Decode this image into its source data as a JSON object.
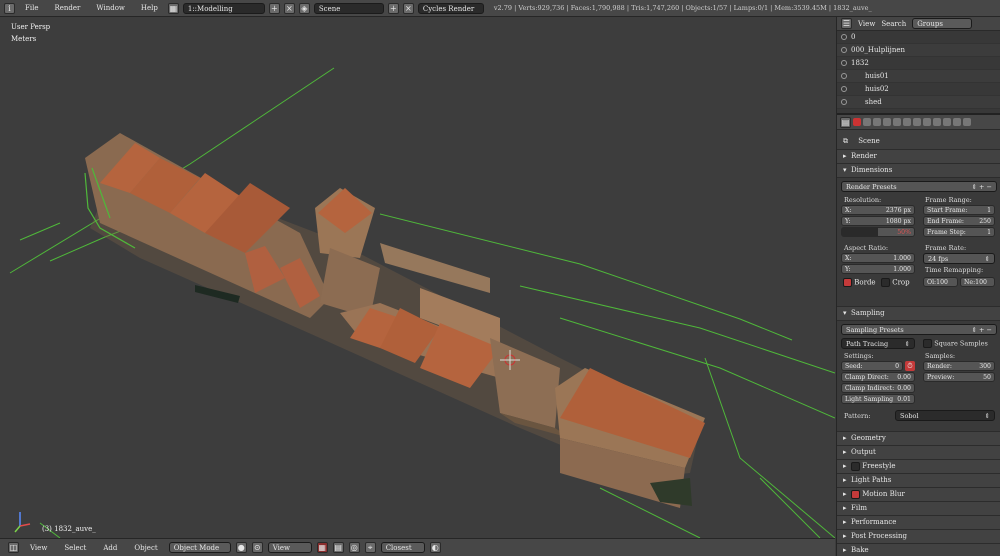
{
  "topbar": {
    "menus": [
      "File",
      "Render",
      "Window",
      "Help"
    ],
    "screen_layout": "1::Modelling",
    "scene": "Scene",
    "render_engine": "Cycles Render",
    "stats": "v2.79 | Verts:929,736 | Faces:1,790,988 | Tris:1,747,260 | Objects:1/57 | Lamps:0/1 | Mem:3539.45M | 1832_auve_"
  },
  "viewport": {
    "view_name": "User Persp",
    "units": "Meters",
    "object_label": "(3) 1832_auve_"
  },
  "bottombar": {
    "menus": [
      "View",
      "Select",
      "Add",
      "Object"
    ],
    "mode": "Object Mode",
    "pivot": "View",
    "snap": "Closest"
  },
  "outliner": {
    "header": {
      "view": "View",
      "search": "Search",
      "display": "Groups"
    },
    "rows": [
      {
        "name": "0"
      },
      {
        "name": "000_Hulplijnen"
      },
      {
        "name": "1832"
      },
      {
        "name": "huis01"
      },
      {
        "name": "huis02"
      },
      {
        "name": "shed"
      }
    ]
  },
  "properties": {
    "context": "Scene",
    "sections": {
      "render": "Render",
      "dimensions": "Dimensions",
      "sampling": "Sampling",
      "geometry": "Geometry",
      "output": "Output",
      "freestyle": "Freestyle",
      "light_paths": "Light Paths",
      "motion_blur": "Motion Blur",
      "film": "Film",
      "performance": "Performance",
      "post_processing": "Post Processing",
      "bake": "Bake"
    },
    "dimensions": {
      "presets": "Render Presets",
      "resolution_label": "Resolution:",
      "res_x_label": "X:",
      "res_x": "2376 px",
      "res_y_label": "Y:",
      "res_y": "1080 px",
      "res_pct": "50%",
      "frame_range_label": "Frame Range:",
      "start_label": "Start Frame:",
      "start": "1",
      "end_label": "End Frame:",
      "end": "250",
      "step_label": "Frame Step:",
      "step": "1",
      "aspect_label": "Aspect Ratio:",
      "asp_x_label": "X:",
      "asp_x": "1.000",
      "asp_y_label": "Y:",
      "asp_y": "1.000",
      "frame_rate_label": "Frame Rate:",
      "frame_rate": "24 fps",
      "time_remap_label": "Time Remapping:",
      "old": "Ol:100",
      "new": "Ne:100",
      "border": "Borde",
      "crop": "Crop"
    },
    "sampling": {
      "presets": "Sampling Presets",
      "integrator": "Path Tracing",
      "square": "Square Samples",
      "settings_label": "Settings:",
      "seed_label": "Seed:",
      "seed": "0",
      "clamp_direct_label": "Clamp Direct:",
      "clamp_direct": "0.00",
      "clamp_indirect_label": "Clamp Indirect:",
      "clamp_indirect": "0.00",
      "light_sampling_label": "Light Sampling",
      "light_sampling": "0.01",
      "samples_label": "Samples:",
      "render_label": "Render:",
      "render": "300",
      "preview_label": "Preview:",
      "preview": "50",
      "pattern_label": "Pattern:",
      "pattern": "Sobol"
    }
  }
}
